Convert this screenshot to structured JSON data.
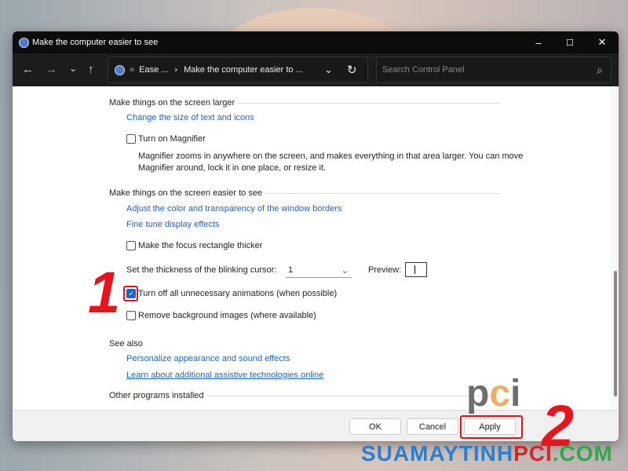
{
  "window": {
    "title": "Make the computer easier to see",
    "minimize": "–",
    "maximize": "☐",
    "close": "✕"
  },
  "toolbar": {
    "back": "←",
    "forward": "→",
    "recent": "⌄",
    "up": "↑",
    "crumb_sep": "«",
    "crumb1": "Ease ...",
    "crumb_arrow": "›",
    "crumb2": "Make the computer easier to ...",
    "dropdown": "⌄",
    "refresh": "↻",
    "search_placeholder": "Search Control Panel",
    "search_icon": "⌕"
  },
  "sections": {
    "larger": {
      "title": "Make things on the screen larger",
      "link": "Change the size of text and icons",
      "magnifier_label": "Turn on Magnifier",
      "magnifier_checked": false,
      "magnifier_desc1": "Magnifier zooms in anywhere on the screen, and makes everything in that area larger. You can move",
      "magnifier_desc2": "Magnifier around, lock it in one place, or resize it."
    },
    "easier": {
      "title": "Make things on the screen easier to see",
      "link1": "Adjust the color and transparency of the window borders",
      "link2": "Fine tune display effects",
      "focus_label": "Make the focus rectangle thicker",
      "focus_checked": false,
      "cursor_label": "Set the thickness of the blinking cursor:",
      "cursor_value": "1",
      "preview_label": "Preview:",
      "animations_label": "Turn off all unnecessary animations (when possible)",
      "animations_checked": true,
      "bg_label": "Remove background images (where available)",
      "bg_checked": false
    },
    "see_also": {
      "title": "See also",
      "link1": "Personalize appearance and sound effects",
      "link2": "Learn about additional assistive technologies online"
    },
    "other": {
      "title": "Other programs installed"
    }
  },
  "footer": {
    "ok": "OK",
    "cancel": "Cancel",
    "apply": "Apply"
  },
  "annotations": {
    "step1": "1",
    "step2": "2",
    "color": "#e5151b"
  },
  "watermark": {
    "part1": "SUAMAYTINH",
    "part2": "PCI",
    "part3": ".COM",
    "logo": "pci"
  }
}
